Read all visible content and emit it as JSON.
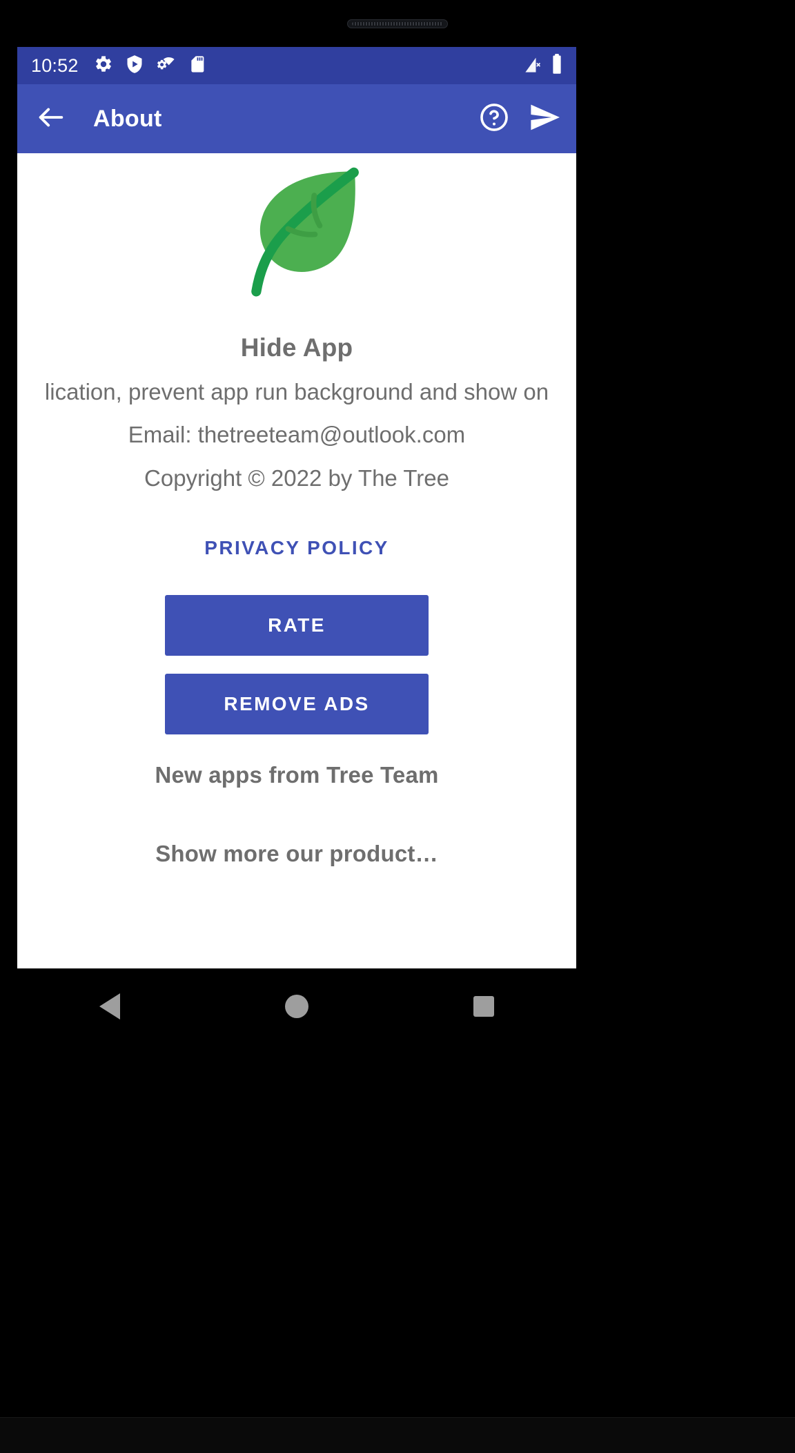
{
  "status_bar": {
    "time": "10:52",
    "left_icons": [
      "settings-gear-icon",
      "play-protect-shield-icon",
      "gear-wifi-icon",
      "sd-card-icon"
    ],
    "right_icons": [
      "signal-no-service-icon",
      "battery-full-icon"
    ],
    "background_color": "#303F9F"
  },
  "toolbar": {
    "back_icon": "arrow-back-icon",
    "title": "About",
    "help_icon": "help-circle-icon",
    "send_icon": "send-icon",
    "background_color": "#3F51B5"
  },
  "content": {
    "logo_icon": "green-leaf-logo",
    "logo_colors": {
      "leaf": "#4CAF50",
      "stem": "#1B9E4B",
      "vein": "#3E9E44"
    },
    "app_name": "Hide App",
    "description": "lication, prevent app run background and show on",
    "email": "Email: thetreeteam@outlook.com",
    "copyright": "Copyright © 2022 by The Tree",
    "privacy_policy_label": "PRIVACY POLICY",
    "privacy_policy_color": "#3F51B5",
    "rate_label": "RATE",
    "remove_ads_label": "REMOVE ADS",
    "new_apps_heading": "New apps from Tree Team",
    "show_more_label": "Show more our product…",
    "text_color": "#6e6e6e",
    "background_color": "#ffffff"
  },
  "nav_bar": {
    "back_icon": "nav-back-triangle-icon",
    "home_icon": "nav-home-circle-icon",
    "recents_icon": "nav-recents-square-icon",
    "background_color": "#000000"
  }
}
